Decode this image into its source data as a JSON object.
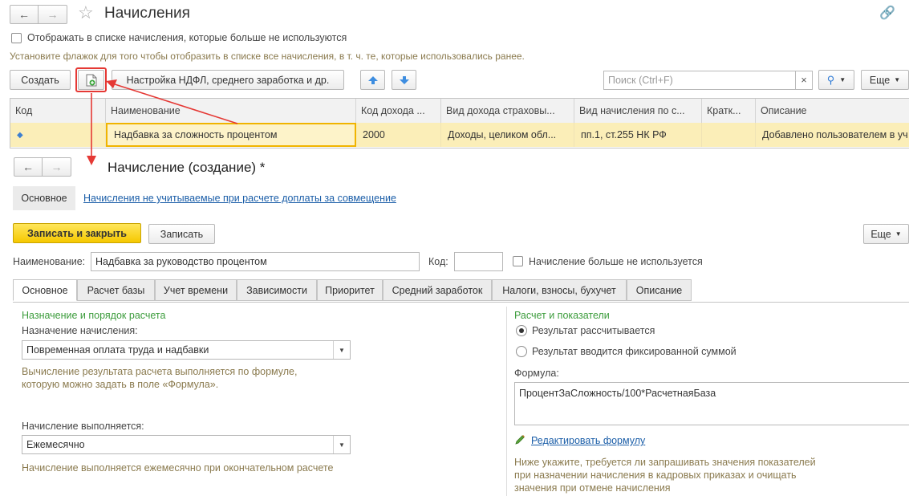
{
  "list_window": {
    "title": "Начисления",
    "show_unused_label": "Отображать в списке начисления, которые больше не используются",
    "hint": "Установите флажок для того чтобы отобразить в списке все начисления, в т. ч. те, которые использовались ранее.",
    "toolbar": {
      "create_label": "Создать",
      "ndfl_settings_label": "Настройка НДФЛ, среднего заработка и др.",
      "search_placeholder": "Поиск (Ctrl+F)",
      "search_clear": "×",
      "more_label": "Еще"
    },
    "table": {
      "columns": [
        "Код",
        "Наименование",
        "Код дохода ...",
        "Вид дохода страховы...",
        "Вид начисления по с...",
        "Кратк...",
        "Описание"
      ],
      "rows": [
        {
          "code": "",
          "name": "Надбавка за сложность процентом",
          "income_code": "2000",
          "insurance_income": "Доходы, целиком обл...",
          "accrual_type": "пп.1, ст.255 НК РФ",
          "short": "",
          "description": "Добавлено пользователем в уч"
        }
      ]
    }
  },
  "form": {
    "title": "Начисление (создание) *",
    "nav_tabs": [
      "Основное",
      "Начисления не учитываемые при расчете доплаты за совмещение"
    ],
    "save_close_label": "Записать и закрыть",
    "save_label": "Записать",
    "more_label": "Еще",
    "name_label": "Наименование:",
    "name_value": "Надбавка за руководство процентом",
    "code_label": "Код:",
    "code_value": "",
    "unused_label": "Начисление больше не используется",
    "tabs": [
      "Основное",
      "Расчет базы",
      "Учет времени",
      "Зависимости",
      "Приоритет",
      "Средний заработок",
      "Налоги, взносы, бухучет",
      "Описание"
    ],
    "left": {
      "section_title": "Назначение и порядок расчета",
      "purpose_label": "Назначение начисления:",
      "purpose_value": "Повременная оплата труда и надбавки",
      "purpose_hint": "Вычисление результата расчета выполняется по формуле, которую можно задать в поле «Формула».",
      "period_label": "Начисление выполняется:",
      "period_value": "Ежемесячно",
      "period_hint": "Начисление выполняется ежемесячно при окончательном расчете"
    },
    "right": {
      "section_title": "Расчет и показатели",
      "radio_calculated": "Результат рассчитывается",
      "radio_fixed": "Результат вводится фиксированной суммой",
      "formula_label": "Формула:",
      "formula_value": "ПроцентЗаСложность/100*РасчетнаяБаза",
      "edit_formula_label": "Редактировать формулу",
      "bottom_hint": "Ниже укажите, требуется ли запрашивать значения показателей при назначении начисления в кадровых приказах и очищать значения при отмене начисления"
    }
  },
  "colors": {
    "accent_yellow": "#f5c800",
    "selected_row": "#fbeeb8",
    "highlight_red": "#e53935",
    "section_green": "#3c9c3c",
    "link_blue": "#1b5ea8"
  }
}
